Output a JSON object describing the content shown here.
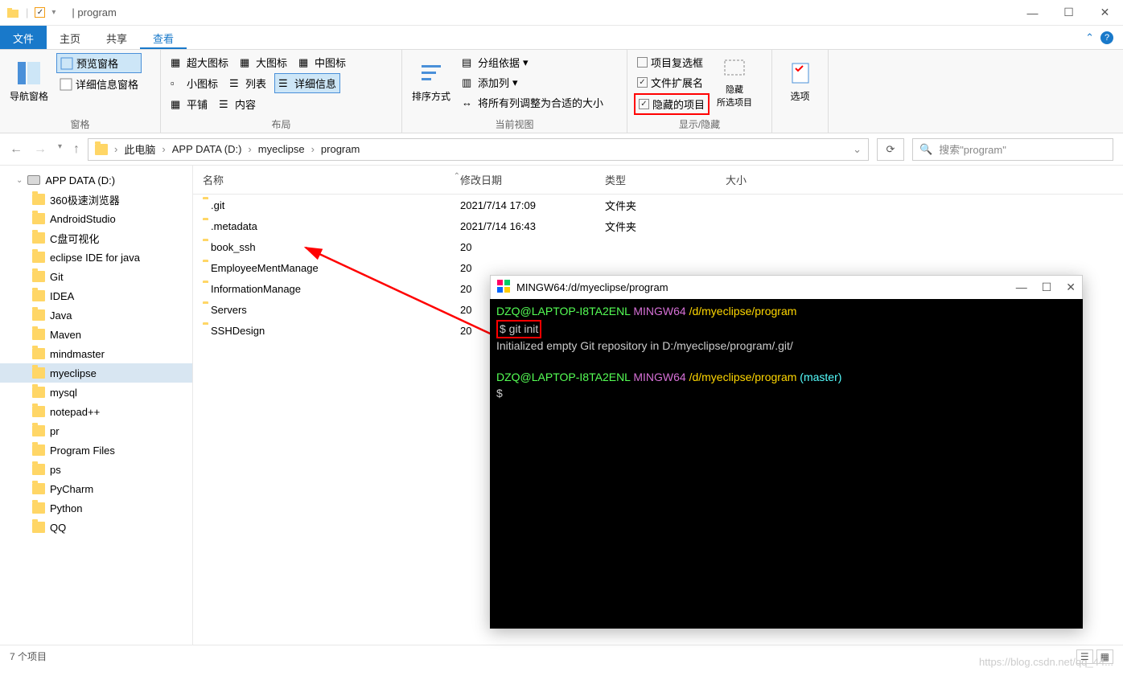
{
  "title": "program",
  "ribbon_tabs": {
    "file": "文件",
    "home": "主页",
    "share": "共享",
    "view": "查看"
  },
  "ribbon": {
    "pane": {
      "nav": "导航窗格",
      "preview": "预览窗格",
      "details": "详细信息窗格",
      "label": "窗格"
    },
    "layout": {
      "xl": "超大图标",
      "lg": "大图标",
      "md": "中图标",
      "sm": "小图标",
      "list": "列表",
      "detail": "详细信息",
      "tiles": "平铺",
      "content": "内容",
      "label": "布局"
    },
    "view": {
      "sort": "排序方式",
      "group": "分组依据",
      "addcol": "添加列",
      "fitcols": "将所有列调整为合适的大小",
      "label": "当前视图"
    },
    "showhide": {
      "checkboxes": "项目复选框",
      "extensions": "文件扩展名",
      "hidden": "隐藏的项目",
      "hidebtn": "隐藏\n所选项目",
      "label": "显示/隐藏"
    },
    "options": "选项"
  },
  "breadcrumbs": [
    "此电脑",
    "APP DATA (D:)",
    "myeclipse",
    "program"
  ],
  "search_placeholder": "搜索\"program\"",
  "sidebar_root": "APP DATA (D:)",
  "sidebar_items": [
    "360极速浏览器",
    "AndroidStudio",
    "C盘可视化",
    "eclipse IDE for java",
    "Git",
    "IDEA",
    "Java",
    "Maven",
    "mindmaster",
    "myeclipse",
    "mysql",
    "notepad++",
    "pr",
    "Program Files",
    "ps",
    "PyCharm",
    "Python",
    "QQ"
  ],
  "columns": {
    "name": "名称",
    "date": "修改日期",
    "type": "类型",
    "size": "大小"
  },
  "files": [
    {
      "name": ".git",
      "date": "2021/7/14 17:09",
      "type": "文件夹"
    },
    {
      "name": ".metadata",
      "date": "2021/7/14 16:43",
      "type": "文件夹"
    },
    {
      "name": "book_ssh",
      "date": "20",
      "type": ""
    },
    {
      "name": "EmployeeMentManage",
      "date": "20",
      "type": ""
    },
    {
      "name": "InformationManage",
      "date": "20",
      "type": ""
    },
    {
      "name": "Servers",
      "date": "20",
      "type": ""
    },
    {
      "name": "SSHDesign",
      "date": "20",
      "type": ""
    }
  ],
  "status": "7 个项目",
  "terminal": {
    "title": "MINGW64:/d/myeclipse/program",
    "user": "DZQ@LAPTOP-I8TA2ENL",
    "host": "MINGW64",
    "path": "/d/myeclipse/program",
    "cmd": "$ git init",
    "output": "Initialized empty Git repository in D:/myeclipse/program/.git/",
    "branch": "(master)",
    "prompt2": "$"
  },
  "watermark": "https://blog.csdn.net/qq_44..."
}
